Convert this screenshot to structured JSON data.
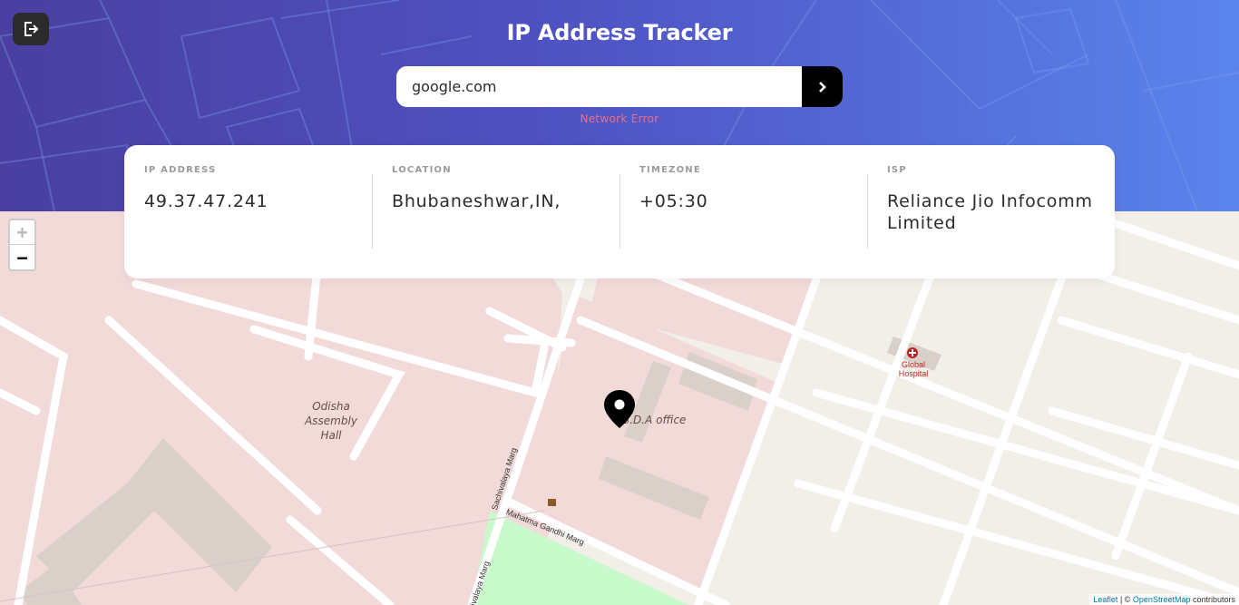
{
  "header": {
    "title": "IP Address Tracker",
    "logout_icon": "logout-icon",
    "gradient": [
      "#4a3fa0",
      "#5a84ec"
    ]
  },
  "search": {
    "value": "google.com",
    "placeholder": "",
    "submit_icon": "chevron-right-icon",
    "error": "Network Error",
    "error_color": "#e8708a"
  },
  "info": [
    {
      "label": "IP ADDRESS",
      "value": "49.37.47.241"
    },
    {
      "label": "LOCATION",
      "value": "Bhubaneshwar,IN,"
    },
    {
      "label": "TIMEZONE",
      "value": "+05:30"
    },
    {
      "label": "ISP",
      "value": "Reliance Jio Infocomm Limited"
    }
  ],
  "map": {
    "zoom_in": "+",
    "zoom_out": "−",
    "labels": {
      "assembly": "Odisha Assembly Hall",
      "bda": "B.D.A office",
      "hospital": "Global Hospital",
      "street_sachivalaya": "Sachivalaya Marg",
      "street_mahatma": "Mahatma Gandhi Marg",
      "street_sachivalaya_2": "Sachivalaya Marg"
    },
    "marker_icon": "location-pin-icon",
    "attribution": {
      "leaflet": "Leaflet",
      "separator": " | © ",
      "osm": "OpenStreetMap",
      "contributors": " contributors"
    }
  }
}
